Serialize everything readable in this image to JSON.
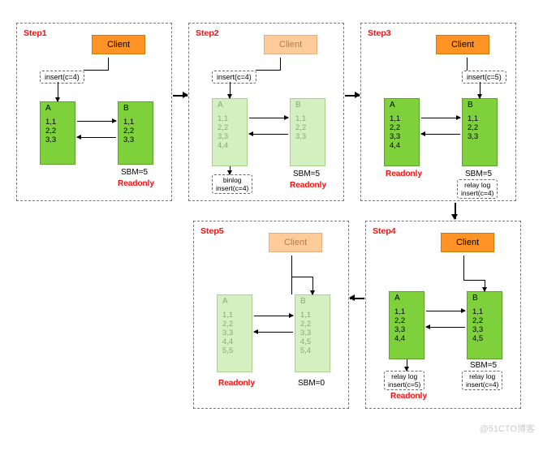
{
  "steps": {
    "s1": {
      "label": "Step1",
      "client": "Client",
      "insert": "insert(c=4)",
      "A": {
        "title": "A",
        "rows": [
          "1,1",
          "2,2",
          "3,3"
        ]
      },
      "B": {
        "title": "B",
        "rows": [
          "1,1",
          "2,2",
          "3,3"
        ]
      },
      "sbm": "SBM=5",
      "readonly": "Readonly"
    },
    "s2": {
      "label": "Step2",
      "client": "Client",
      "insert": "insert(c=4)",
      "A": {
        "title": "A",
        "rows": [
          "1,1",
          "2,2",
          "3,3",
          "4,4"
        ]
      },
      "B": {
        "title": "B",
        "rows": [
          "1,1",
          "2,2",
          "3,3"
        ]
      },
      "binlog": {
        "l1": "binlog",
        "l2": "insert(c=4)"
      },
      "sbm": "SBM=5",
      "readonly": "Readonly"
    },
    "s3": {
      "label": "Step3",
      "client": "Client",
      "insert": "insert(c=5)",
      "A": {
        "title": "A",
        "rows": [
          "1,1",
          "2,2",
          "3,3",
          "4,4"
        ]
      },
      "B": {
        "title": "B",
        "rows": [
          "1,1",
          "2,2",
          "3,3"
        ]
      },
      "sbm": "SBM=5",
      "readonly": "Readonly",
      "relaylog": {
        "l1": "relay log",
        "l2": "insert(c=4)"
      }
    },
    "s4": {
      "label": "Step4",
      "client": "Client",
      "A": {
        "title": "A",
        "rows": [
          "1,1",
          "2,2",
          "3,3",
          "4,4"
        ]
      },
      "B": {
        "title": "B",
        "rows": [
          "1,1",
          "2,2",
          "3,3",
          "4,5"
        ]
      },
      "sbm": "SBM=5",
      "readonly": "Readonly",
      "relaylogA": {
        "l1": "relay log",
        "l2": "insert(c=5)"
      },
      "relaylogB": {
        "l1": "relay log",
        "l2": "insert(c=4)"
      }
    },
    "s5": {
      "label": "Step5",
      "client": "Client",
      "A": {
        "title": "A",
        "rows": [
          "1,1",
          "2,2",
          "3,3",
          "4,4",
          "5,5"
        ]
      },
      "B": {
        "title": "B",
        "rows": [
          "1,1",
          "2,2",
          "3,3",
          "4,5",
          "5,4"
        ]
      },
      "sbm": "SBM=0",
      "readonly": "Readonly"
    }
  },
  "watermark": "@51CTO博客"
}
